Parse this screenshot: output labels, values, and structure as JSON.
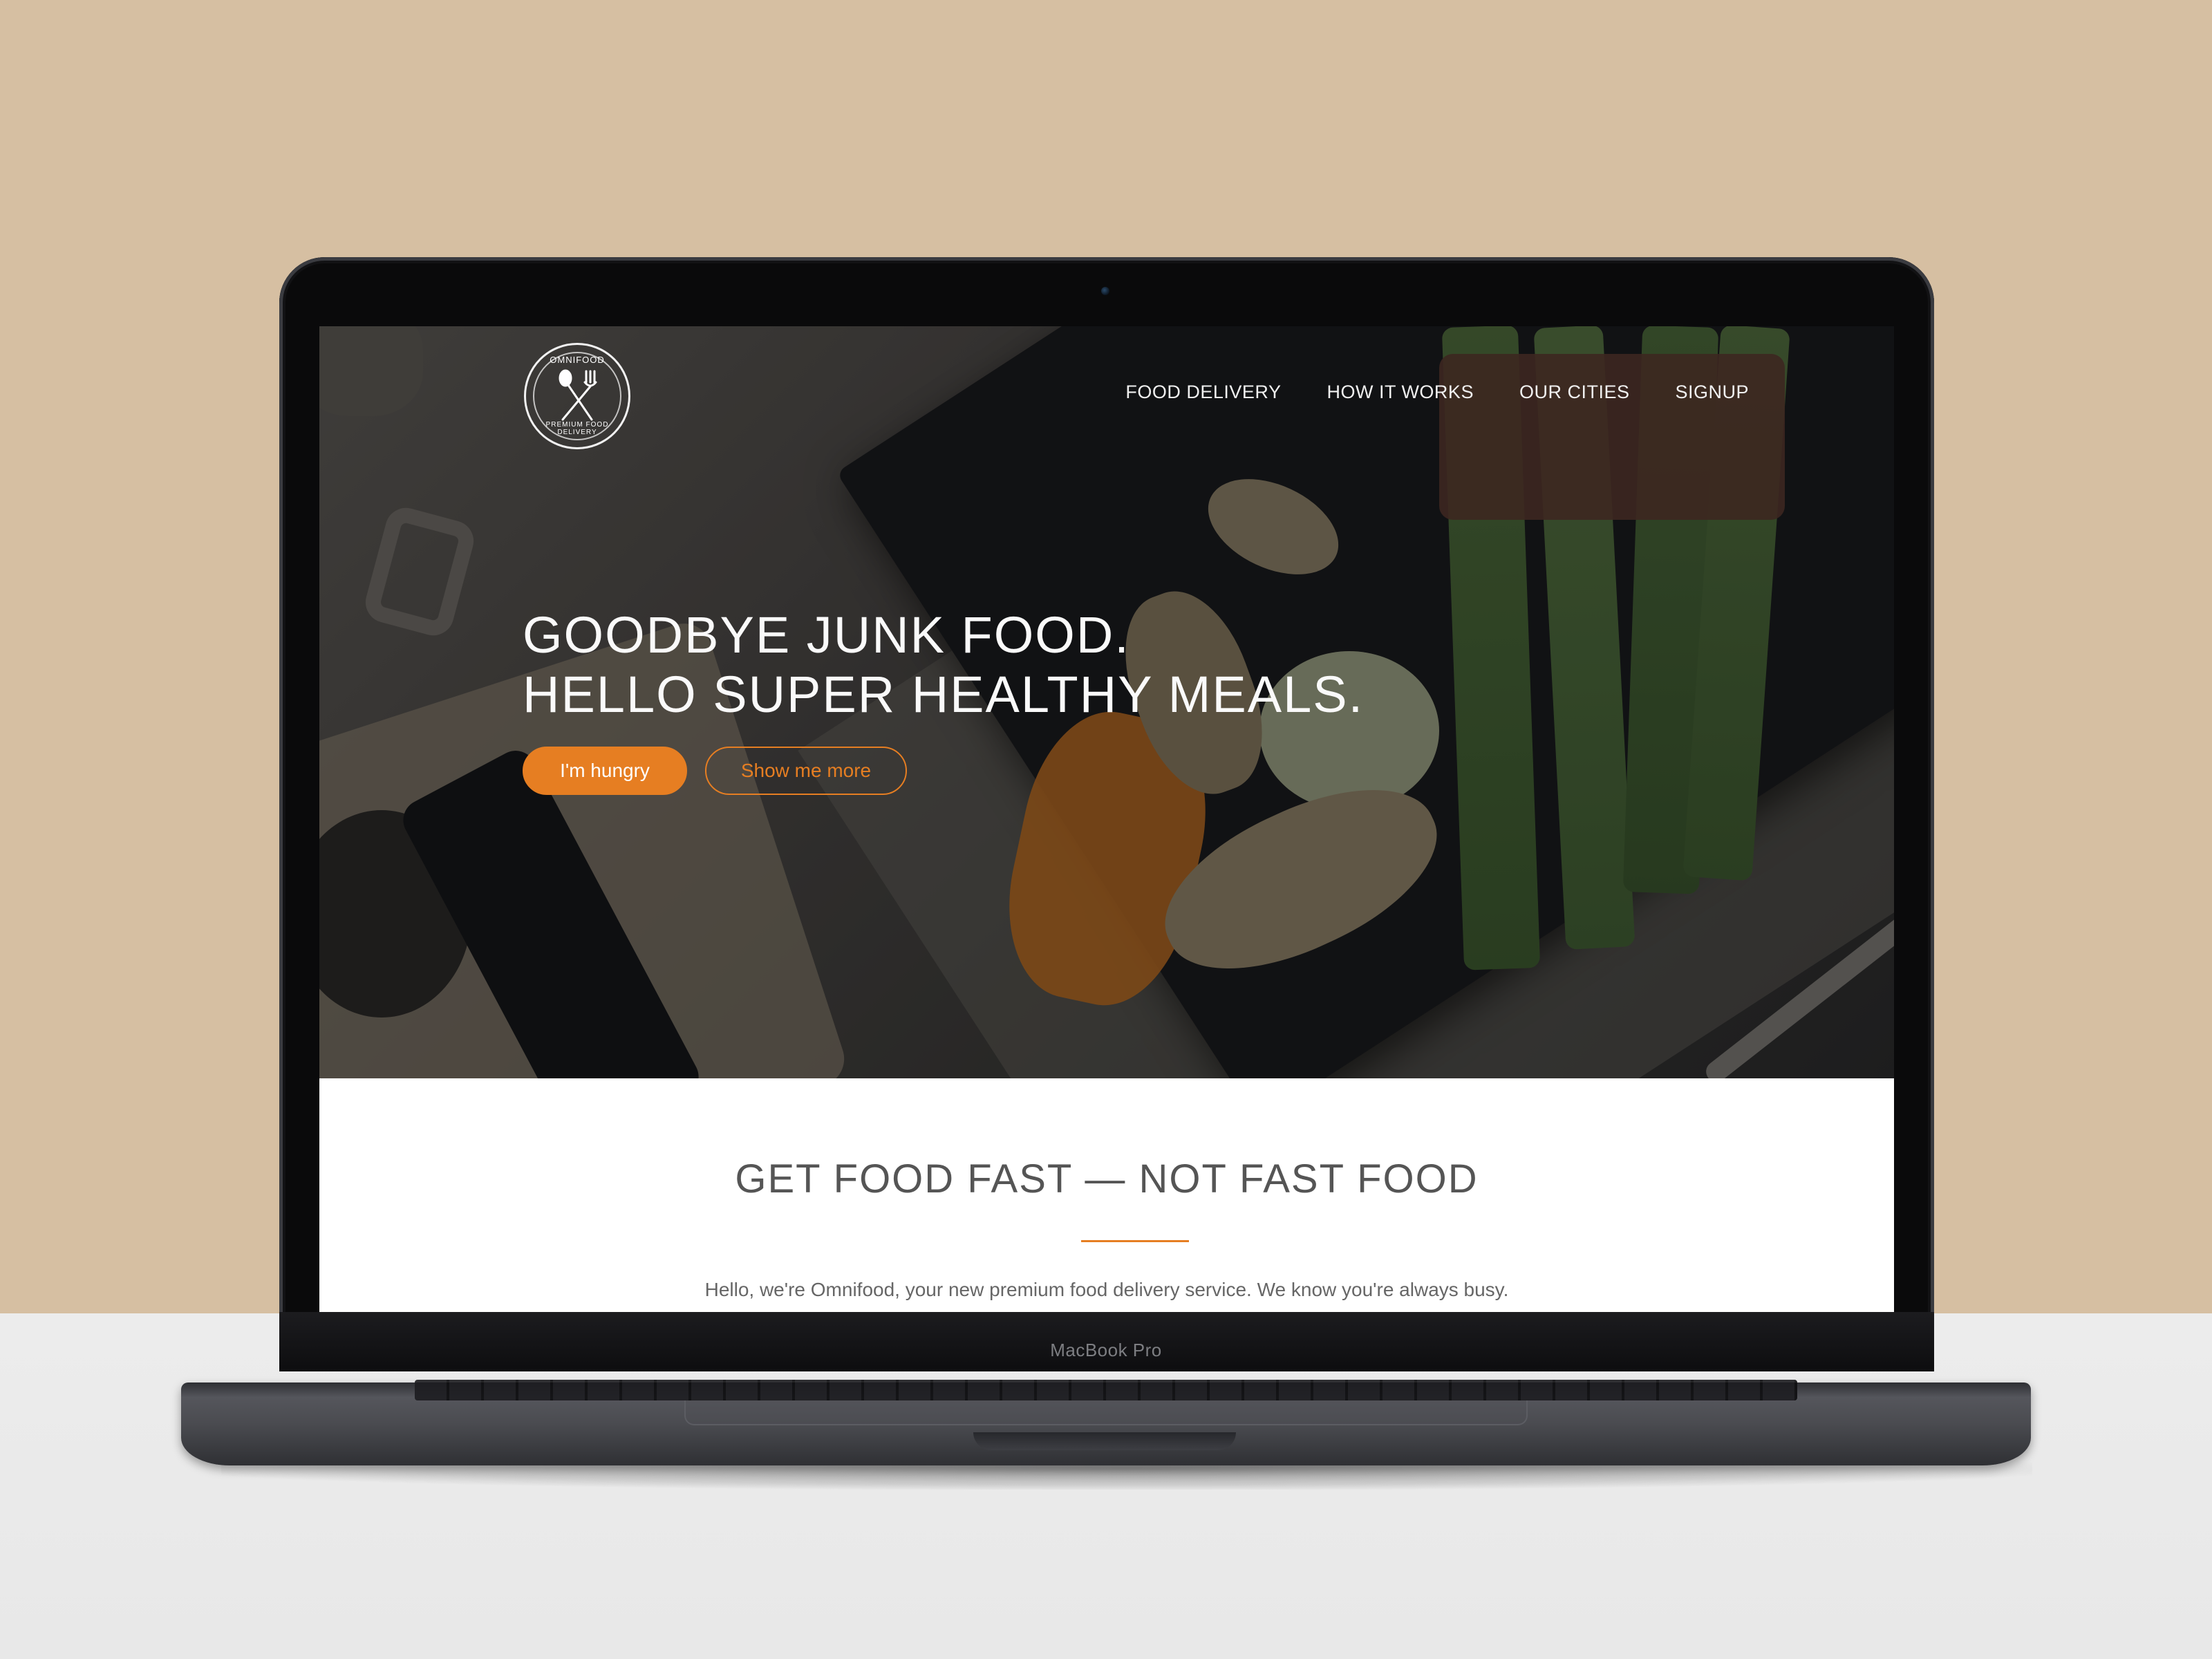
{
  "colors": {
    "accent": "#e67e22",
    "wall": "#d6bfa2",
    "desk": "#ececec",
    "text_dark": "#555555"
  },
  "logo": {
    "icon": "spoon-fork-icon",
    "top_text": "OMNIFOOD",
    "bottom_text": "PREMIUM FOOD DELIVERY"
  },
  "nav": {
    "items": [
      "FOOD DELIVERY",
      "HOW IT WORKS",
      "OUR CITIES",
      "SIGNUP"
    ]
  },
  "hero": {
    "line1": "GOODBYE JUNK FOOD.",
    "line2": "HELLO SUPER HEALTHY MEALS.",
    "primary_button": "I'm hungry",
    "secondary_button": "Show me more"
  },
  "features": {
    "title": "GET FOOD FAST — NOT FAST FOOD",
    "text": "Hello, we're Omnifood, your new premium food delivery service. We know you're always busy."
  },
  "device": {
    "label": "MacBook Pro"
  }
}
